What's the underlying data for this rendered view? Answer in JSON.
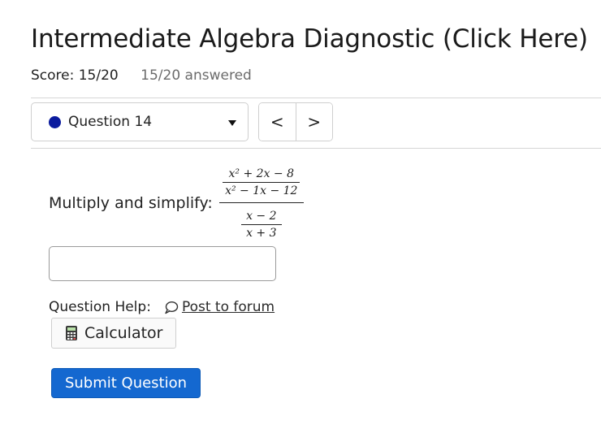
{
  "page": {
    "title": "Intermediate Algebra Diagnostic (Click Here)",
    "score": "Score: 15/20",
    "answered": "15/20 answered"
  },
  "navigation": {
    "question_select_label": "Question 14",
    "question_dot_color": "#0b1b9e",
    "prev_symbol": "<",
    "next_symbol": ">"
  },
  "question": {
    "prompt": "Multiply and simplify:",
    "expression": {
      "top_numerator": "x² + 2x − 8",
      "top_denominator": "x² − 1x − 12",
      "bottom_numerator": "x − 2",
      "bottom_denominator": "x + 3"
    },
    "answer_value": ""
  },
  "help": {
    "label": "Question Help:",
    "forum_link": "Post to forum",
    "calculator_label": "Calculator"
  },
  "actions": {
    "submit_label": "Submit Question",
    "submit_color": "#1468d0"
  }
}
